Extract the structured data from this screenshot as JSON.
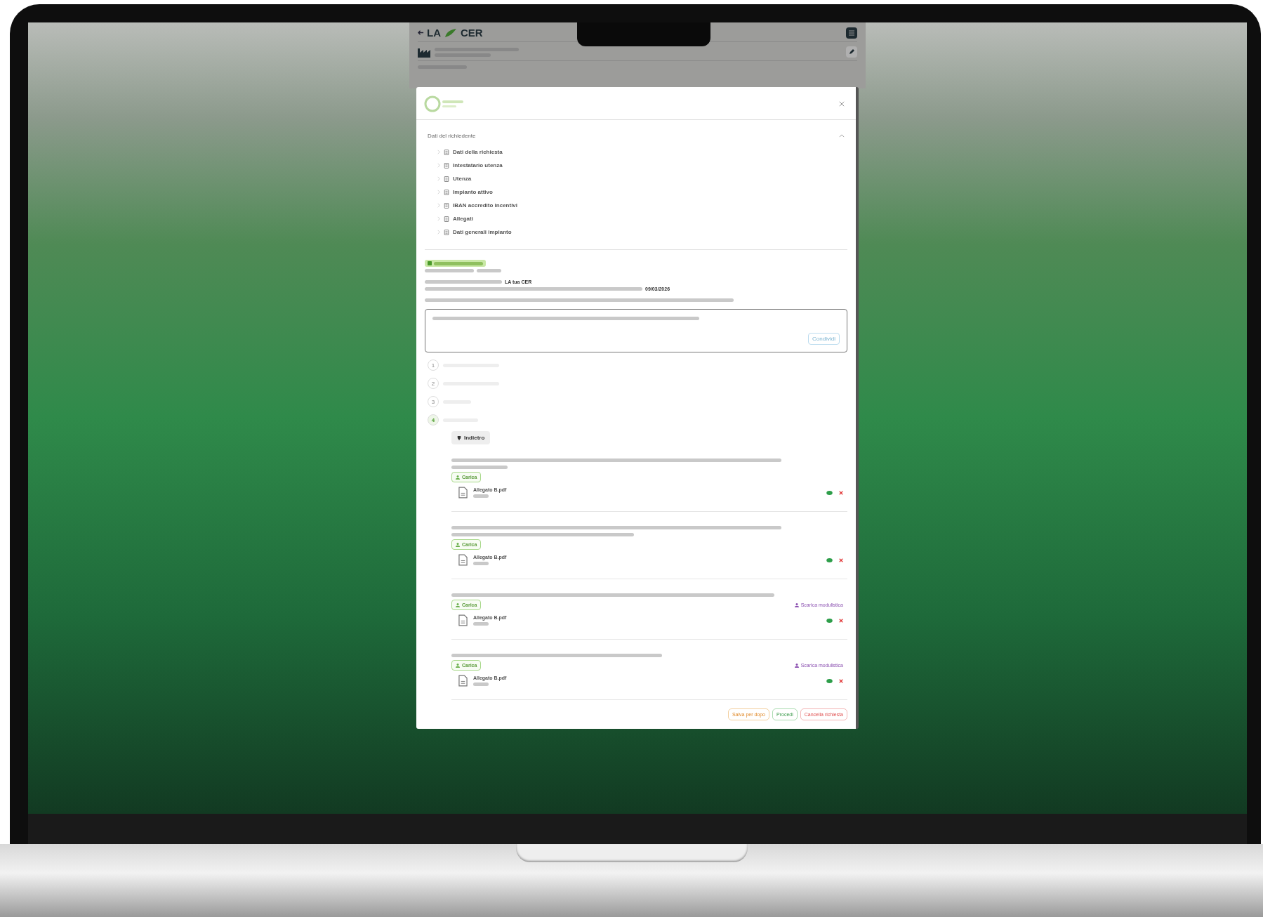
{
  "app_header": {
    "logo_prefix": "LA",
    "logo_suffix": "CER"
  },
  "modal": {
    "accordion": {
      "title": "Dati del richiedente",
      "expanded": true,
      "items": [
        {
          "label": "Dati della richiesta"
        },
        {
          "label": "Intestatario utenza"
        },
        {
          "label": "Utenza"
        },
        {
          "label": "Impianto attivo"
        },
        {
          "label": "IBAN accredito incentivi"
        },
        {
          "label": "Allegati"
        },
        {
          "label": "Dati generali impianto"
        }
      ]
    },
    "request_summary": {
      "cer_name": "LA tua CER",
      "deadline": "09/03/2026"
    },
    "message_box": {
      "button": "Condividi"
    },
    "steps": [
      {
        "number": "1",
        "selected": false
      },
      {
        "number": "2",
        "selected": false
      },
      {
        "number": "3",
        "selected": false
      },
      {
        "number": "4",
        "selected": true
      }
    ],
    "back_button": "Indietro",
    "documents": [
      {
        "upload_button": "Carica",
        "file_name": "Allegato B.pdf"
      },
      {
        "upload_button": "Carica",
        "file_name": "Allegato B.pdf"
      },
      {
        "upload_button": "Carica",
        "file_name": "Allegato B.pdf",
        "download_link": "Scarica modulistica"
      },
      {
        "upload_button": "Carica",
        "file_name": "Allegato B.pdf",
        "download_link": "Scarica modulistica"
      }
    ],
    "footer_buttons": [
      {
        "label": "Salva per dopo",
        "kind": "warning"
      },
      {
        "label": "Procedi",
        "kind": "success"
      },
      {
        "label": "Cancella richiesta",
        "kind": "danger"
      }
    ]
  }
}
